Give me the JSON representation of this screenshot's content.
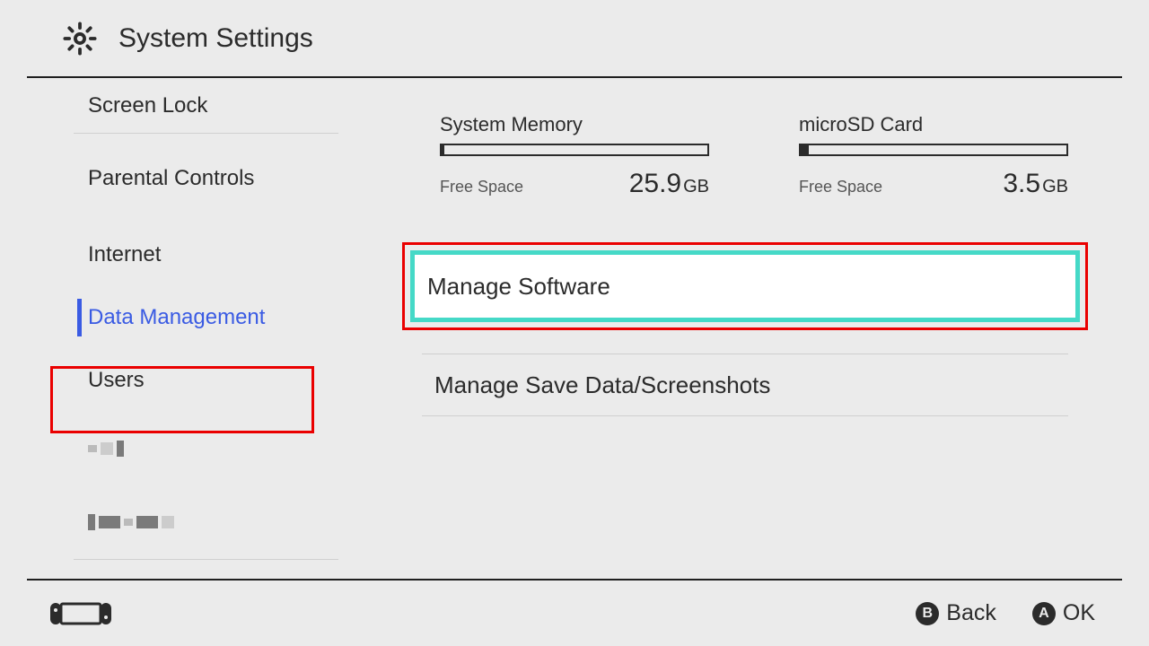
{
  "header": {
    "title": "System Settings"
  },
  "sidebar": {
    "items": [
      {
        "label": "Screen Lock"
      },
      {
        "label": "Parental Controls"
      },
      {
        "label": "Internet"
      },
      {
        "label": "Data Management",
        "active": true
      },
      {
        "label": "Users"
      }
    ]
  },
  "storage": {
    "system": {
      "title": "System Memory",
      "free_label": "Free Space",
      "value": "25.9",
      "unit": "GB",
      "fill_pct": 1
    },
    "sd": {
      "title": "microSD Card",
      "free_label": "Free Space",
      "value": "3.5",
      "unit": "GB",
      "fill_pct": 3
    }
  },
  "menu": {
    "manage_software": "Manage Software",
    "manage_save": "Manage Save Data/Screenshots"
  },
  "footer": {
    "back_glyph": "B",
    "back_label": "Back",
    "ok_glyph": "A",
    "ok_label": "OK"
  }
}
